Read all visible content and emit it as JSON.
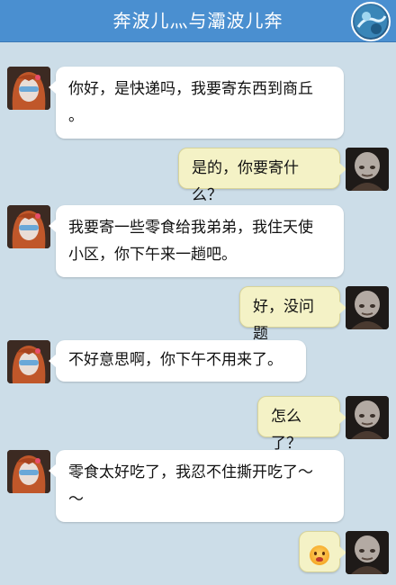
{
  "header": {
    "title": "奔波儿灬与灞波儿奔"
  },
  "messages": [
    {
      "side": "in",
      "avatar": "girl-avatar",
      "lines": [
        "你好，是快递吗，我要寄东西到商丘",
        "。"
      ]
    },
    {
      "side": "out",
      "avatar": "monk-avatar",
      "lines": [
        "是的，你要寄什么？"
      ]
    },
    {
      "side": "in",
      "avatar": "girl-avatar",
      "lines": [
        "我要寄一些零食给我弟弟，我住天使",
        "小区，你下午来一趟吧。"
      ]
    },
    {
      "side": "out",
      "avatar": "monk-avatar",
      "lines": [
        "好，没问题"
      ]
    },
    {
      "side": "in",
      "avatar": "girl-avatar",
      "lines": [
        "不好意思啊，你下午不用来了。"
      ]
    },
    {
      "side": "out",
      "avatar": "monk-avatar",
      "lines": [
        "怎么了？"
      ]
    },
    {
      "side": "in",
      "avatar": "girl-avatar",
      "lines": [
        "零食太好吃了，我忍不住撕开吃了～",
        "～"
      ]
    },
    {
      "side": "out",
      "avatar": "monk-avatar",
      "emoji": "shocked-face-emoji"
    }
  ],
  "colors": {
    "header_bg": "#4a8fd0",
    "chat_bg": "#ccdde8",
    "incoming_bubble": "#ffffff",
    "outgoing_bubble": "#f4f2c6"
  }
}
